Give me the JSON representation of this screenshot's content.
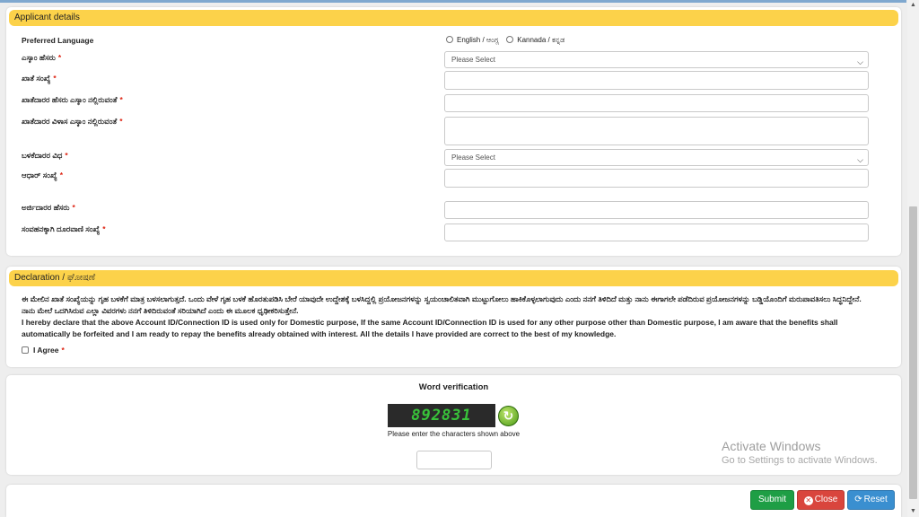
{
  "applicant": {
    "header": "Applicant details",
    "preferred_language_label": "Preferred Language",
    "language_options": [
      "English / ಆಂಗ್ಲ",
      "Kannada / ಕನ್ನಡ"
    ],
    "fields": [
      {
        "label": "ಎಸ್ಕಾಂ ಹೆಸರು",
        "type": "select",
        "value": "Please Select"
      },
      {
        "label": "ಖಾತೆ ಸಂಖ್ಯೆ",
        "type": "text",
        "value": ""
      },
      {
        "label": "ಖಾತೆದಾರರ ಹೆಸರು ಎಸ್ಕಾಂ ನಲ್ಲಿರುವಂತೆ",
        "type": "text",
        "value": ""
      },
      {
        "label": "ಖಾತೆದಾರರ ವಿಳಾಸ ಎಸ್ಕಾಂ ನಲ್ಲಿರುವಂತೆ",
        "type": "textarea",
        "value": ""
      },
      {
        "label": "ಬಳಕೆದಾರರ ವಿಧ",
        "type": "select",
        "value": "Please Select"
      },
      {
        "label": "ಆಧಾರ್ ಸಂಖ್ಯೆ",
        "type": "text",
        "value": ""
      },
      {
        "label": "ಅರ್ಜಿದಾರರ ಹೆಸರು",
        "type": "text",
        "value": ""
      },
      {
        "label": "ಸಂವಹನಕ್ಕಾಗಿ ದೂರವಾಣಿ ಸಂಖ್ಯೆ",
        "type": "text",
        "value": ""
      }
    ],
    "required_mark": "*"
  },
  "declaration": {
    "header": "Declaration / ಘೋಷಣೆ",
    "kannada_text": "ಈ ಮೇಲಿನ ಖಾತೆ ಸಂಖ್ಯೆಯನ್ನು ಗೃಹ ಬಳಕೆಗೆ ಮಾತ್ರ ಬಳಸಲಾಗುತ್ತದೆ. ಒಂದು ವೇಳೆ ಗೃಹ ಬಳಕೆ ಹೊರತುಪಡಿಸಿ ಬೇರೆ ಯಾವುದೇ ಉದ್ದೇಶಕ್ಕೆ ಬಳಸಿದ್ದಲ್ಲಿ ಪ್ರಯೋಜನಗಳನ್ನು ಸ್ವಯಂಚಾಲಿತವಾಗಿ ಮುಟ್ಟುಗೋಲು ಹಾಕಿಕೊಳ್ಳಲಾಗುವುದು ಎಂದು ನನಗೆ ತಿಳಿದಿದೆ ಮತ್ತು ನಾನು ಈಗಾಗಲೇ ಪಡೆದಿರುವ ಪ್ರಯೋಜನಗಳನ್ನು ಬಡ್ಡಿಯೊಂದಿಗೆ ಮರುಪಾವತಿಸಲು ಸಿದ್ಧನಿದ್ದೇನೆ. ನಾನು ಮೇಲೆ ಒದಗಿಸಿರುವ ಎಲ್ಲಾ ವಿವರಗಳು ನನಗೆ ತಿಳಿದಿರುವಂತೆ ಸರಿಯಾಗಿದೆ ಎಂದು ಈ ಮೂಲಕ ಧೃಢೀಕರಿಸುತ್ತೇನೆ.",
    "english_text": "I hereby declare that the above Account ID/Connection ID is used only for Domestic purpose, If the same Account ID/Connection ID is used for any other purpose other than Domestic purpose, I am aware that the benefits shall automatically be forfeited and I am ready to repay the benefits already obtained with interest. All the details I have provided are correct to the best of my knowledge.",
    "agree_label": "I Agree",
    "required_mark": "*"
  },
  "verification": {
    "title": "Word verification",
    "captcha_text": "892831",
    "hint": "Please enter the characters shown above",
    "input_value": ""
  },
  "actions": {
    "submit": "Submit",
    "close": "Close",
    "reset": "Reset"
  },
  "watermark": {
    "line1": "Activate Windows",
    "line2": "Go to Settings to activate Windows."
  },
  "colors": {
    "panel_header": "#fcd24a",
    "submit": "#1e9e45",
    "close": "#d9453d",
    "reset": "#3a8fd0"
  }
}
